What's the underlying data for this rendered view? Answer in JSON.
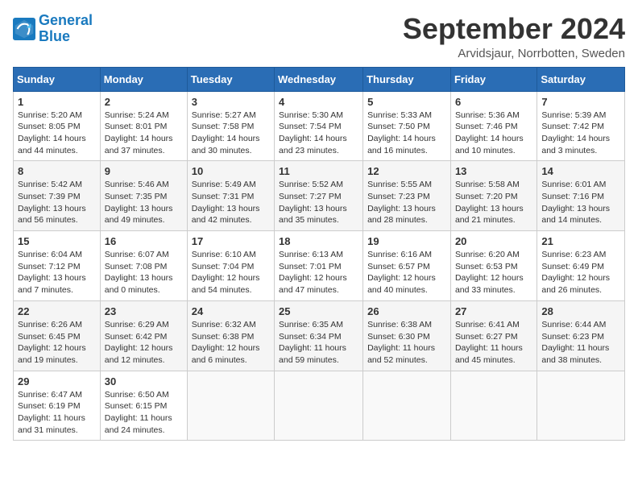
{
  "header": {
    "logo_general": "General",
    "logo_blue": "Blue",
    "month_title": "September 2024",
    "location": "Arvidsjaur, Norrbotten, Sweden"
  },
  "calendar": {
    "days_of_week": [
      "Sunday",
      "Monday",
      "Tuesday",
      "Wednesday",
      "Thursday",
      "Friday",
      "Saturday"
    ],
    "weeks": [
      [
        null,
        {
          "day": "2",
          "sunrise": "Sunrise: 5:24 AM",
          "sunset": "Sunset: 8:01 PM",
          "daylight": "Daylight: 14 hours and 37 minutes."
        },
        {
          "day": "3",
          "sunrise": "Sunrise: 5:27 AM",
          "sunset": "Sunset: 7:58 PM",
          "daylight": "Daylight: 14 hours and 30 minutes."
        },
        {
          "day": "4",
          "sunrise": "Sunrise: 5:30 AM",
          "sunset": "Sunset: 7:54 PM",
          "daylight": "Daylight: 14 hours and 23 minutes."
        },
        {
          "day": "5",
          "sunrise": "Sunrise: 5:33 AM",
          "sunset": "Sunset: 7:50 PM",
          "daylight": "Daylight: 14 hours and 16 minutes."
        },
        {
          "day": "6",
          "sunrise": "Sunrise: 5:36 AM",
          "sunset": "Sunset: 7:46 PM",
          "daylight": "Daylight: 14 hours and 10 minutes."
        },
        {
          "day": "7",
          "sunrise": "Sunrise: 5:39 AM",
          "sunset": "Sunset: 7:42 PM",
          "daylight": "Daylight: 14 hours and 3 minutes."
        }
      ],
      [
        {
          "day": "1",
          "sunrise": "Sunrise: 5:20 AM",
          "sunset": "Sunset: 8:05 PM",
          "daylight": "Daylight: 14 hours and 44 minutes."
        },
        {
          "day": "8",
          "sunrise": "Sunrise: 5:42 AM",
          "sunset": "Sunset: 7:39 PM",
          "daylight": "Daylight: 13 hours and 56 minutes."
        },
        {
          "day": "9",
          "sunrise": "Sunrise: 5:46 AM",
          "sunset": "Sunset: 7:35 PM",
          "daylight": "Daylight: 13 hours and 49 minutes."
        },
        {
          "day": "10",
          "sunrise": "Sunrise: 5:49 AM",
          "sunset": "Sunset: 7:31 PM",
          "daylight": "Daylight: 13 hours and 42 minutes."
        },
        {
          "day": "11",
          "sunrise": "Sunrise: 5:52 AM",
          "sunset": "Sunset: 7:27 PM",
          "daylight": "Daylight: 13 hours and 35 minutes."
        },
        {
          "day": "12",
          "sunrise": "Sunrise: 5:55 AM",
          "sunset": "Sunset: 7:23 PM",
          "daylight": "Daylight: 13 hours and 28 minutes."
        },
        {
          "day": "13",
          "sunrise": "Sunrise: 5:58 AM",
          "sunset": "Sunset: 7:20 PM",
          "daylight": "Daylight: 13 hours and 21 minutes."
        },
        {
          "day": "14",
          "sunrise": "Sunrise: 6:01 AM",
          "sunset": "Sunset: 7:16 PM",
          "daylight": "Daylight: 13 hours and 14 minutes."
        }
      ],
      [
        {
          "day": "15",
          "sunrise": "Sunrise: 6:04 AM",
          "sunset": "Sunset: 7:12 PM",
          "daylight": "Daylight: 13 hours and 7 minutes."
        },
        {
          "day": "16",
          "sunrise": "Sunrise: 6:07 AM",
          "sunset": "Sunset: 7:08 PM",
          "daylight": "Daylight: 13 hours and 0 minutes."
        },
        {
          "day": "17",
          "sunrise": "Sunrise: 6:10 AM",
          "sunset": "Sunset: 7:04 PM",
          "daylight": "Daylight: 12 hours and 54 minutes."
        },
        {
          "day": "18",
          "sunrise": "Sunrise: 6:13 AM",
          "sunset": "Sunset: 7:01 PM",
          "daylight": "Daylight: 12 hours and 47 minutes."
        },
        {
          "day": "19",
          "sunrise": "Sunrise: 6:16 AM",
          "sunset": "Sunset: 6:57 PM",
          "daylight": "Daylight: 12 hours and 40 minutes."
        },
        {
          "day": "20",
          "sunrise": "Sunrise: 6:20 AM",
          "sunset": "Sunset: 6:53 PM",
          "daylight": "Daylight: 12 hours and 33 minutes."
        },
        {
          "day": "21",
          "sunrise": "Sunrise: 6:23 AM",
          "sunset": "Sunset: 6:49 PM",
          "daylight": "Daylight: 12 hours and 26 minutes."
        }
      ],
      [
        {
          "day": "22",
          "sunrise": "Sunrise: 6:26 AM",
          "sunset": "Sunset: 6:45 PM",
          "daylight": "Daylight: 12 hours and 19 minutes."
        },
        {
          "day": "23",
          "sunrise": "Sunrise: 6:29 AM",
          "sunset": "Sunset: 6:42 PM",
          "daylight": "Daylight: 12 hours and 12 minutes."
        },
        {
          "day": "24",
          "sunrise": "Sunrise: 6:32 AM",
          "sunset": "Sunset: 6:38 PM",
          "daylight": "Daylight: 12 hours and 6 minutes."
        },
        {
          "day": "25",
          "sunrise": "Sunrise: 6:35 AM",
          "sunset": "Sunset: 6:34 PM",
          "daylight": "Daylight: 11 hours and 59 minutes."
        },
        {
          "day": "26",
          "sunrise": "Sunrise: 6:38 AM",
          "sunset": "Sunset: 6:30 PM",
          "daylight": "Daylight: 11 hours and 52 minutes."
        },
        {
          "day": "27",
          "sunrise": "Sunrise: 6:41 AM",
          "sunset": "Sunset: 6:27 PM",
          "daylight": "Daylight: 11 hours and 45 minutes."
        },
        {
          "day": "28",
          "sunrise": "Sunrise: 6:44 AM",
          "sunset": "Sunset: 6:23 PM",
          "daylight": "Daylight: 11 hours and 38 minutes."
        }
      ],
      [
        {
          "day": "29",
          "sunrise": "Sunrise: 6:47 AM",
          "sunset": "Sunset: 6:19 PM",
          "daylight": "Daylight: 11 hours and 31 minutes."
        },
        {
          "day": "30",
          "sunrise": "Sunrise: 6:50 AM",
          "sunset": "Sunset: 6:15 PM",
          "daylight": "Daylight: 11 hours and 24 minutes."
        },
        null,
        null,
        null,
        null,
        null
      ]
    ]
  }
}
